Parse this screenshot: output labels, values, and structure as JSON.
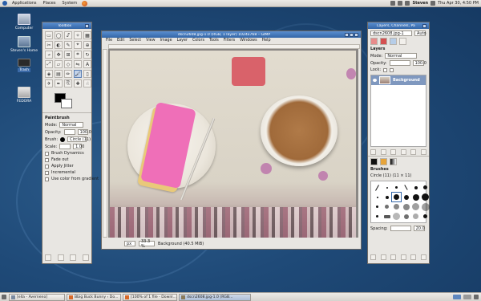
{
  "top_panel": {
    "menus": [
      "Applications",
      "Places",
      "System"
    ],
    "user": "Steven",
    "clock": "Thu Apr 30,  4:50 PM"
  },
  "desktop_icons": [
    {
      "label": "Computer"
    },
    {
      "label": "Steven's Home"
    },
    {
      "label": "Trash"
    },
    {
      "label": "FEDORA"
    }
  ],
  "toolbox": {
    "title": "Toolbox",
    "options_title": "Paintbrush",
    "mode_label": "Mode:",
    "mode_value": "Normal",
    "opacity_label": "Opacity:",
    "opacity_value": "100.0",
    "brush_label": "Brush:",
    "brush_value": "Circle (11)",
    "scale_label": "Scale:",
    "scale_value": "1.00",
    "checks": [
      "Brush Dynamics",
      "Fade out",
      "Apply Jitter",
      "Incremental",
      "Use color from gradient"
    ]
  },
  "image_window": {
    "title": "dscn2608.jpg-1.0 (RGB, 1 layer) 1024x768 – GIMP",
    "menus": [
      "File",
      "Edit",
      "Select",
      "View",
      "Image",
      "Layer",
      "Colors",
      "Tools",
      "Filters",
      "Windows",
      "Help"
    ],
    "unit": "px",
    "zoom": "33.3 %",
    "status": "Background (40.5 MiB)"
  },
  "layers_dock": {
    "title": "Layers, Channels, Pa",
    "image_select": "dscn2608.jpg-1",
    "auto_label": "Auto",
    "section": "Layers",
    "mode_label": "Mode:",
    "mode_value": "Normal",
    "opacity_label": "Opacity:",
    "opacity_value": "100.0",
    "lock_label": "Lock:",
    "layer_name": "Background",
    "brushes_title": "Brushes",
    "brush_name": "Circle (11) (11 × 11)",
    "spacing_label": "Spacing:",
    "spacing_value": "20.0"
  },
  "taskbar": {
    "tasks": [
      "[ella - Averneno]",
      "Bbig Buck Bunny ‹ Do...",
      "[100% of 1 file - Downl...",
      "dscn2608.jpg-1.0 (RGB..."
    ]
  },
  "colors": {
    "desktop": "#1f4a78",
    "titlebar": "#3467a8",
    "layer_selected": "#7f98bf",
    "cake_icing": "#ef6fb8"
  }
}
